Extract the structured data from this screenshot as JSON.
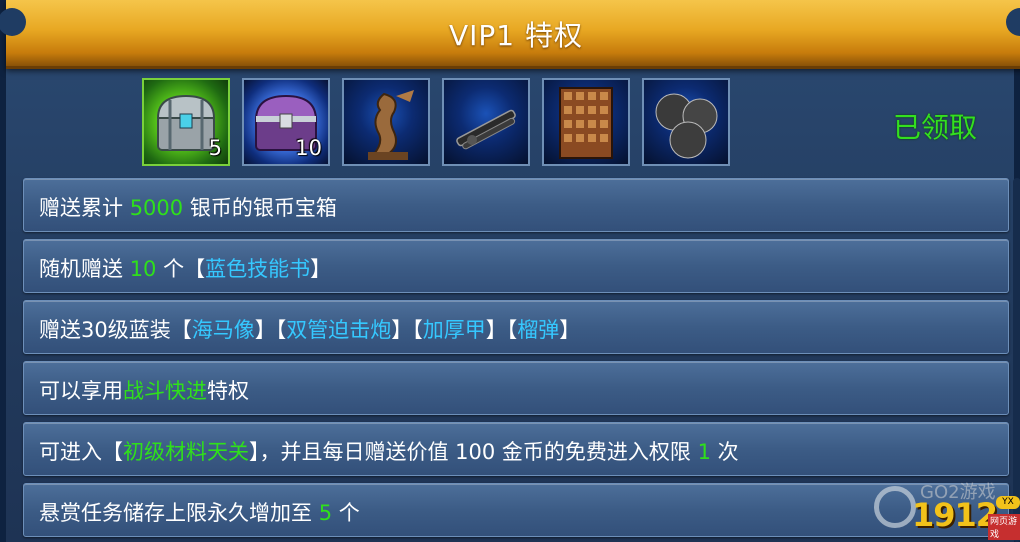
{
  "header": {
    "title": "VIP1 特权"
  },
  "items": [
    {
      "name": "silver-coin-chest",
      "count": "5"
    },
    {
      "name": "purple-treasure-chest",
      "count": "10"
    },
    {
      "name": "seahorse-statue",
      "count": ""
    },
    {
      "name": "double-barrel-mortar",
      "count": ""
    },
    {
      "name": "thickened-armor",
      "count": ""
    },
    {
      "name": "shrapnel-shells",
      "count": ""
    }
  ],
  "status": {
    "claimed_label": "已领取"
  },
  "benefits": [
    {
      "parts": [
        {
          "text": "赠送累计 ",
          "style": "w"
        },
        {
          "text": "5000",
          "style": "g"
        },
        {
          "text": " 银币的银币宝箱",
          "style": "w"
        }
      ]
    },
    {
      "parts": [
        {
          "text": "随机赠送 ",
          "style": "w"
        },
        {
          "text": "10",
          "style": "g"
        },
        {
          "text": " 个【",
          "style": "w"
        },
        {
          "text": "蓝色技能书",
          "style": "c"
        },
        {
          "text": "】",
          "style": "w"
        }
      ]
    },
    {
      "parts": [
        {
          "text": "赠送30级蓝装【",
          "style": "w"
        },
        {
          "text": "海马像",
          "style": "c"
        },
        {
          "text": "】【",
          "style": "w"
        },
        {
          "text": "双管迫击炮",
          "style": "c"
        },
        {
          "text": "】【",
          "style": "w"
        },
        {
          "text": "加厚甲",
          "style": "c"
        },
        {
          "text": "】【",
          "style": "w"
        },
        {
          "text": "榴弹",
          "style": "c"
        },
        {
          "text": "】",
          "style": "w"
        }
      ]
    },
    {
      "parts": [
        {
          "text": "可以享用",
          "style": "w"
        },
        {
          "text": "战斗快进",
          "style": "g"
        },
        {
          "text": "特权",
          "style": "w"
        }
      ]
    },
    {
      "parts": [
        {
          "text": "可进入【",
          "style": "w"
        },
        {
          "text": "初级材料天关",
          "style": "g"
        },
        {
          "text": "】，并且每日赠送价值 100 金币的免费进入权限 ",
          "style": "w"
        },
        {
          "text": "1",
          "style": "g"
        },
        {
          "text": " 次",
          "style": "w"
        }
      ]
    },
    {
      "parts": [
        {
          "text": "悬赏任务储存上限永久增加至 ",
          "style": "w"
        },
        {
          "text": "5",
          "style": "g"
        },
        {
          "text": " 个",
          "style": "w"
        }
      ]
    }
  ],
  "watermark": {
    "site": "GO2游戏",
    "number": "1912",
    "badge": "YX",
    "sub": "网页游戏"
  }
}
